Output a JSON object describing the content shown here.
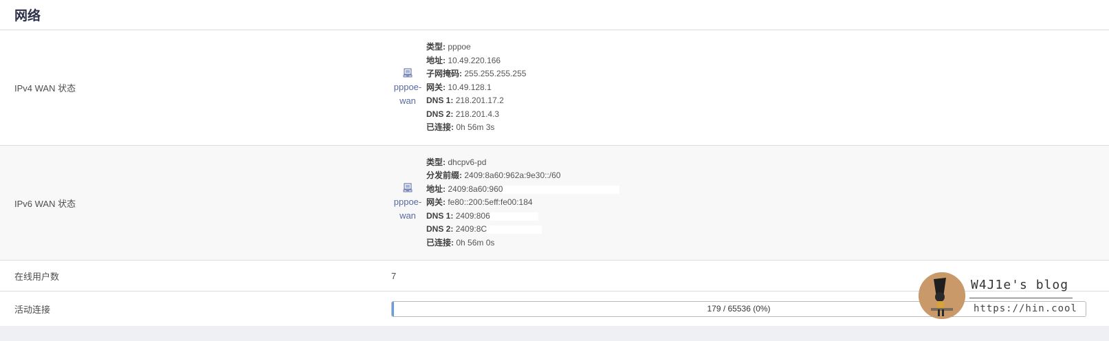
{
  "section": {
    "title": "网络"
  },
  "ipv4": {
    "label": "IPv4 WAN 状态",
    "iface_line1": "pppoe-",
    "iface_line2": "wan",
    "details": [
      {
        "key": "类型:",
        "value": "pppoe"
      },
      {
        "key": "地址:",
        "value": "10.49.220.166"
      },
      {
        "key": "子网掩码:",
        "value": "255.255.255.255"
      },
      {
        "key": "网关:",
        "value": "10.49.128.1"
      },
      {
        "key": "DNS 1:",
        "value": "218.201.17.2"
      },
      {
        "key": "DNS 2:",
        "value": "218.201.4.3"
      },
      {
        "key": "已连接:",
        "value": "0h 56m 3s"
      }
    ]
  },
  "ipv6": {
    "label": "IPv6 WAN 状态",
    "iface_line1": "pppoe-",
    "iface_line2": "wan",
    "details": [
      {
        "key": "类型:",
        "value": "dhcpv6-pd"
      },
      {
        "key": "分发前缀:",
        "value": "2409:8a60:962a:9e30::/60"
      },
      {
        "key": "地址:",
        "value": "2409:8a60:960"
      },
      {
        "key": "网关:",
        "value": "fe80::200:5eff:fe00:184"
      },
      {
        "key": "DNS 1:",
        "value": "2409:806"
      },
      {
        "key": "DNS 2:",
        "value": "2409:8C"
      },
      {
        "key": "已连接:",
        "value": "0h 56m 0s"
      }
    ]
  },
  "online_users": {
    "label": "在线用户数",
    "value": "7"
  },
  "active_connections": {
    "label": "活动连接",
    "text": "179 / 65536 (0%)",
    "fraction": 0.0027
  },
  "watermark": {
    "title": "W4J1e's  blog",
    "url": "https://hin.cool"
  },
  "colors": {
    "accent": "#5a6aa0",
    "title": "#2c2f48",
    "border": "#dcdcdc"
  }
}
